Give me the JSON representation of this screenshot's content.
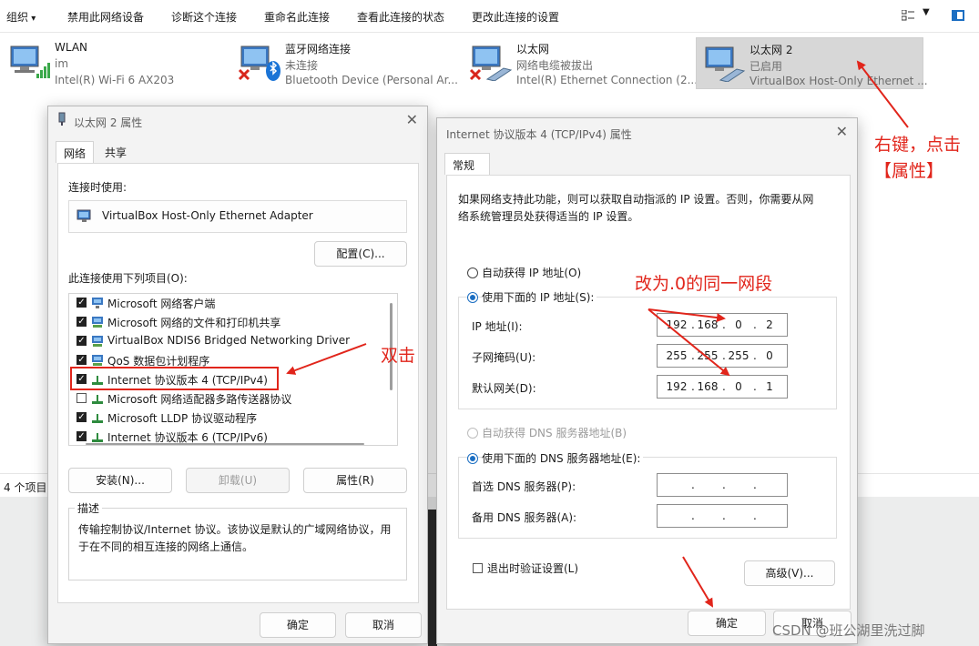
{
  "toolbar": {
    "organize": "组织",
    "disable_device": "禁用此网络设备",
    "diagnose": "诊断这个连接",
    "rename": "重命名此连接",
    "view_status": "查看此连接的状态",
    "change_settings": "更改此连接的设置"
  },
  "adapters": [
    {
      "name": "WLAN",
      "status": "im",
      "device": "Intel(R) Wi-Fi 6 AX203",
      "icon": "wifi-adapter-icon"
    },
    {
      "name": "蓝牙网络连接",
      "status": "未连接",
      "device": "Bluetooth Device (Personal Ar...",
      "icon": "bluetooth-adapter-icon"
    },
    {
      "name": "以太网",
      "status": "网络电缆被拔出",
      "device": "Intel(R) Ethernet Connection (2...",
      "icon": "ethernet-adapter-icon"
    },
    {
      "name": "以太网 2",
      "status": "已启用",
      "device": "VirtualBox Host-Only Ethernet ...",
      "icon": "ethernet-adapter-icon"
    }
  ],
  "explorer_status": {
    "item_count": "4 个项目"
  },
  "properties_dialog": {
    "title": "以太网 2 属性",
    "tabs": [
      "网络",
      "共享"
    ],
    "connect_using_label": "连接时使用:",
    "adapter_name": "VirtualBox Host-Only Ethernet Adapter",
    "configure_button": "配置(C)...",
    "items_label": "此连接使用下列项目(O):",
    "items": [
      {
        "label": "Microsoft 网络客户端",
        "checked": true,
        "icon": "client-icon"
      },
      {
        "label": "Microsoft 网络的文件和打印机共享",
        "checked": true,
        "icon": "service-icon"
      },
      {
        "label": "VirtualBox NDIS6 Bridged Networking Driver",
        "checked": true,
        "icon": "service-icon"
      },
      {
        "label": "QoS 数据包计划程序",
        "checked": true,
        "icon": "service-icon"
      },
      {
        "label": "Internet 协议版本 4 (TCP/IPv4)",
        "checked": true,
        "icon": "protocol-icon"
      },
      {
        "label": "Microsoft 网络适配器多路传送器协议",
        "checked": false,
        "icon": "protocol-icon"
      },
      {
        "label": "Microsoft LLDP 协议驱动程序",
        "checked": true,
        "icon": "protocol-icon"
      },
      {
        "label": "Internet 协议版本 6 (TCP/IPv6)",
        "checked": true,
        "icon": "protocol-icon"
      }
    ],
    "install_button": "安装(N)...",
    "uninstall_button": "卸载(U)",
    "properties_button": "属性(R)",
    "description_label": "描述",
    "description_text": "传输控制协议/Internet 协议。该协议是默认的广域网络协议，用于在不同的相互连接的网络上通信。",
    "ok_button": "确定",
    "cancel_button": "取消"
  },
  "ipv4_dialog": {
    "title": "Internet 协议版本 4 (TCP/IPv4) 属性",
    "tab": "常规",
    "intro": "如果网络支持此功能，则可以获取自动指派的 IP 设置。否则，你需要从网络系统管理员处获得适当的 IP 设置。",
    "auto_ip_label": "自动获得 IP 地址(O)",
    "manual_ip_label": "使用下面的 IP 地址(S):",
    "ip_label": "IP 地址(I):",
    "ip_value": [
      "192",
      "168",
      "0",
      "2"
    ],
    "mask_label": "子网掩码(U):",
    "mask_value": [
      "255",
      "255",
      "255",
      "0"
    ],
    "gateway_label": "默认网关(D):",
    "gateway_value": [
      "192",
      "168",
      "0",
      "1"
    ],
    "auto_dns_label": "自动获得 DNS 服务器地址(B)",
    "manual_dns_label": "使用下面的 DNS 服务器地址(E):",
    "preferred_dns_label": "首选 DNS 服务器(P):",
    "alternate_dns_label": "备用 DNS 服务器(A):",
    "validate_label": "退出时验证设置(L)",
    "advanced_button": "高级(V)...",
    "ok_button": "确定",
    "cancel_button": "取消"
  },
  "annotations": {
    "right_click": "右键，点击",
    "properties": "【属性】",
    "double_click": "双击",
    "change_to": "改为.0的同一网段"
  },
  "watermark": "CSDN @班公湖里洗过脚",
  "colors": {
    "annotation_red": "#e1251b",
    "accent_blue": "#1b6ec2",
    "selected_tile": "#d7d7d7"
  }
}
